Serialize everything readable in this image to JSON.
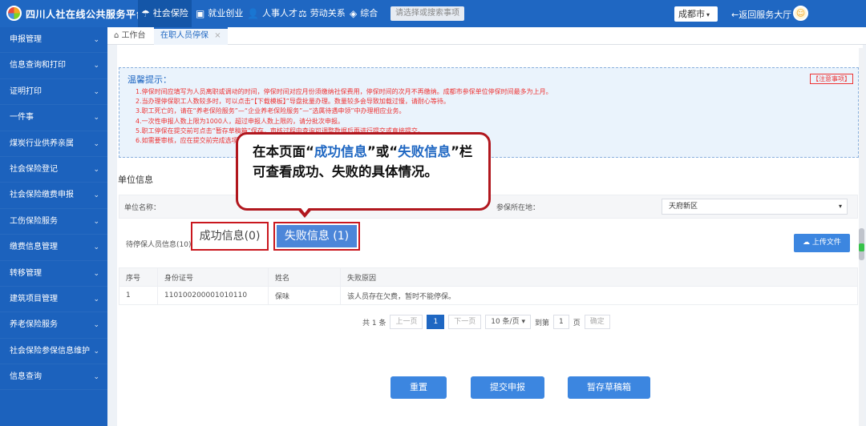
{
  "header": {
    "brand": "四川人社在线公共服务平台",
    "nav": [
      {
        "label": "社会保险",
        "icon": "umbrella-icon"
      },
      {
        "label": "就业创业",
        "icon": "briefcase-icon"
      },
      {
        "label": "人事人才",
        "icon": "people-icon"
      },
      {
        "label": "劳动关系",
        "icon": "scales-icon"
      },
      {
        "label": "综合",
        "icon": "layers-icon"
      }
    ],
    "search_placeholder": "请选择或搜索事项",
    "city": "成都市",
    "back": "←返回服务大厅"
  },
  "sidebar": {
    "items": [
      "申报管理",
      "信息查询和打印",
      "证明打印",
      "一件事",
      "煤炭行业供养亲属",
      "社会保险登记",
      "社会保险缴费申报",
      "工伤保险服务",
      "缴费信息管理",
      "转移管理",
      "建筑项目管理",
      "养老保险服务",
      "社会保险参保信息维护",
      "信息查询"
    ]
  },
  "tabs": [
    "工作台",
    "在职人员停保"
  ],
  "tips": {
    "title": "温馨提示：",
    "note_link": "【注意事项】",
    "lines": [
      "1.停保时间应填写为人员离职或调动的时间，停保时间对应月份须缴纳社保费用，停保时间的次月不再缴纳。成都市参保单位停保时间最多为上月。",
      "2.当办理停保职工人数较多时，可以点击“【下载模板】”导盘批量办理。数量较多会导致加载过慢，请耐心等待。",
      "3.职工死亡的，请在“养老保险服务”—“企业养老保险服务”—“选属待遇申领”中办理相应业务。",
      "4.一次性申报人数上限为1000人，超过申报人数上限的，请分批次申报。",
      "5.职工停保在提交前可点击“暂存草稿箱”保存，审核过程中查询可调整数据后再进行提交或直接提交。",
      "6.如需要审核，应在提交前完成选项。"
    ]
  },
  "unit": {
    "section_title": "单位信息",
    "name_label": "单位名称：",
    "region_label": "参保所在地：",
    "region_value": "天府新区"
  },
  "list": {
    "pending": "待停保人员信息(10)",
    "success_tab": "成功信息(0)",
    "fail_tab": "失败信息 (1)",
    "upload": "上传文件"
  },
  "table": {
    "headers": [
      "序号",
      "身份证号",
      "姓名",
      "失败原因"
    ],
    "rows": [
      [
        "1",
        "110100200001010110",
        "保味",
        "该人员存在欠费，暂时不能停保。"
      ]
    ]
  },
  "pager": {
    "total": "共 1 条",
    "prev": "上一页",
    "current": "1",
    "next": "下一页",
    "size": "10 条/页",
    "goto": "到第",
    "page_input": "1",
    "page_unit": "页",
    "confirm": "确定"
  },
  "actions": {
    "reset": "重置",
    "submit": "提交申报",
    "draft": "暂存草稿箱"
  },
  "callout": {
    "p1": "在本页面“",
    "hl1": "成功信息",
    "p2": "”或“",
    "hl2": "失败信息",
    "p3": "”栏可查看成功、失败的具体情况。"
  }
}
